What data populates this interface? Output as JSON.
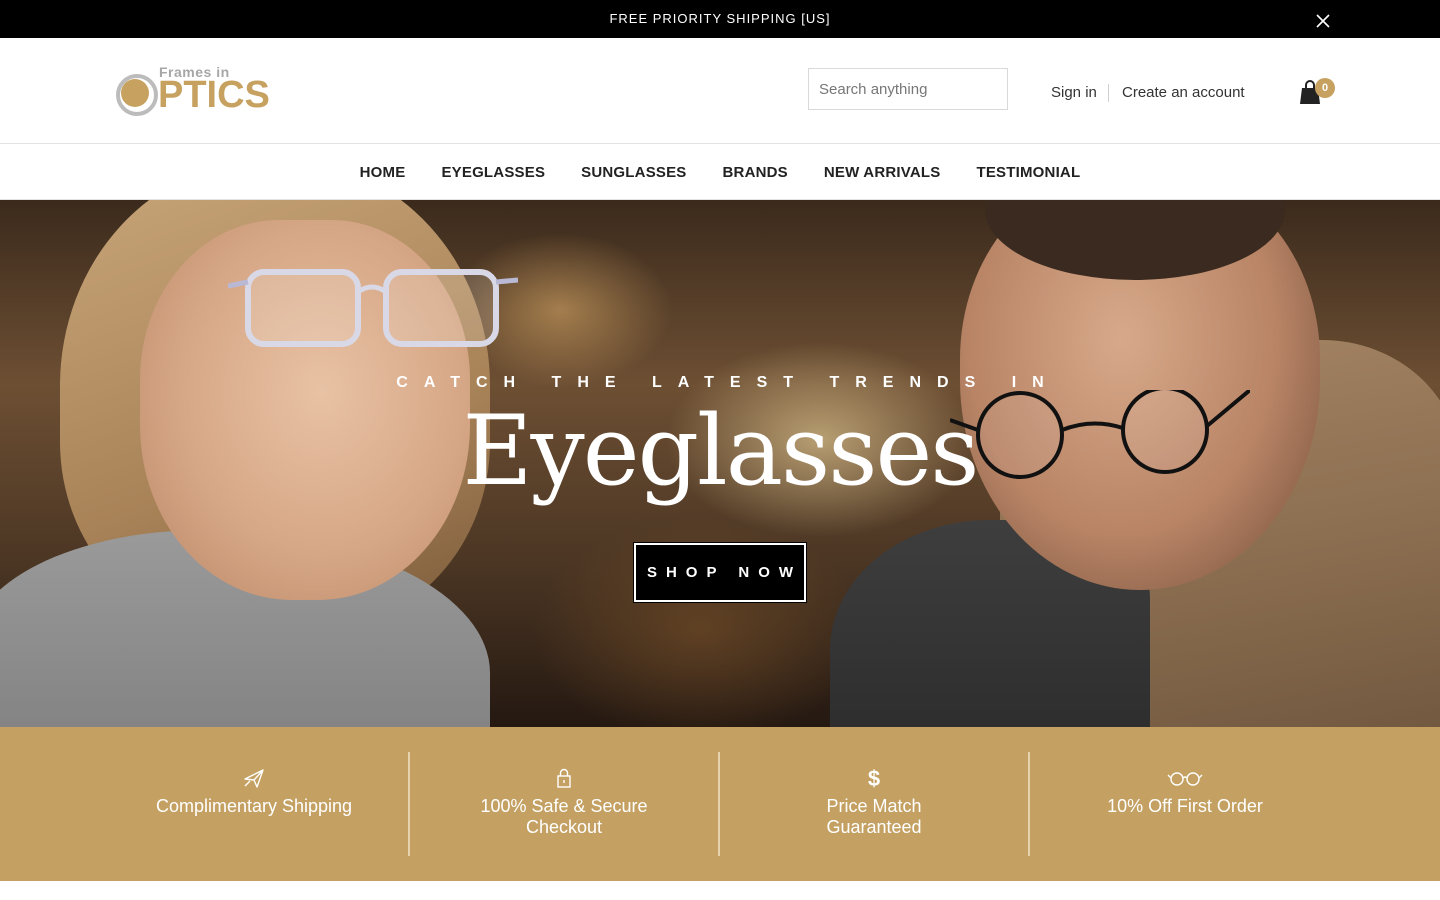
{
  "announcement": {
    "text": "FREE PRIORITY SHIPPING [US]"
  },
  "header": {
    "logo_small": "Frames in",
    "logo_big": "PTICS",
    "search_placeholder": "Search anything",
    "signin": "Sign in",
    "create_account": "Create an account",
    "cart_count": "0"
  },
  "nav": {
    "items": [
      "HOME",
      "EYEGLASSES",
      "SUNGLASSES",
      "BRANDS",
      "NEW ARRIVALS",
      "TESTIMONIAL"
    ]
  },
  "hero": {
    "tagline": "CATCH THE LATEST TRENDS IN",
    "title": "Eyeglasses",
    "button": "SHOP NOW"
  },
  "features": [
    {
      "icon": "airplane-icon",
      "text": "Complimentary Shipping"
    },
    {
      "icon": "lock-icon",
      "text": "100% Safe & Secure Checkout"
    },
    {
      "icon": "dollar-icon",
      "text": "Price Match Guaranteed"
    },
    {
      "icon": "glasses-icon",
      "text": "10% Off First Order"
    }
  ],
  "colors": {
    "accent": "#c4a163",
    "announcement_bg": "#000000"
  }
}
